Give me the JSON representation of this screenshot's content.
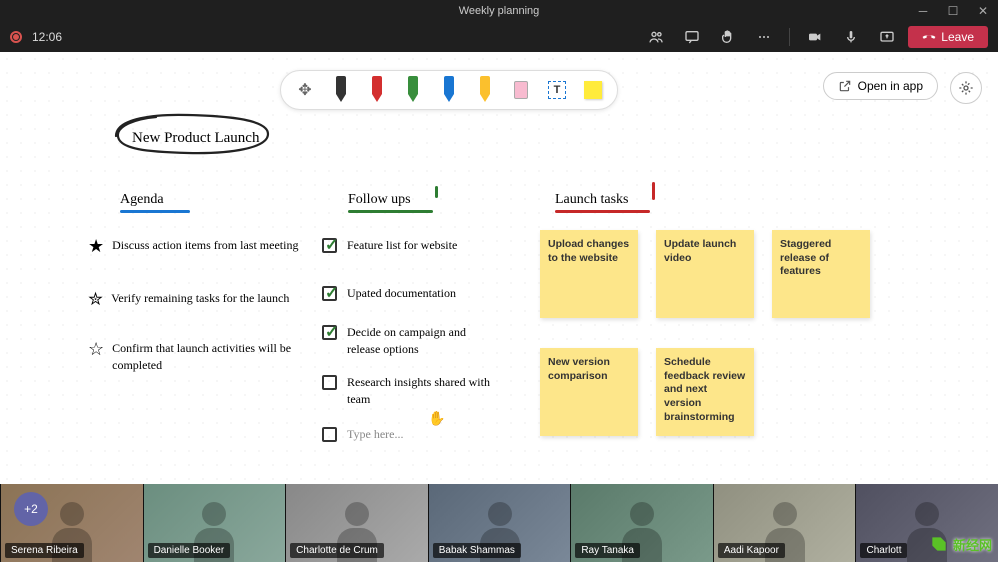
{
  "window": {
    "title": "Weekly planning"
  },
  "meeting_bar": {
    "timer": "12:06",
    "leave_label": "Leave"
  },
  "whiteboard": {
    "open_app_label": "Open in app",
    "title": "New Product Launch",
    "sections": {
      "agenda": {
        "label": "Agenda",
        "items": [
          "Discuss action items from last meeting",
          "Verify remaining tasks for the launch",
          "Confirm that launch activities will be completed"
        ]
      },
      "followups": {
        "label": "Follow ups",
        "items": [
          {
            "text": "Feature list for website",
            "checked": true
          },
          {
            "text": "Upated documentation",
            "checked": true
          },
          {
            "text": "Decide on campaign and release options",
            "checked": true
          },
          {
            "text": "Research insights shared with team",
            "checked": false
          }
        ],
        "placeholder": "Type here..."
      },
      "launch_tasks": {
        "label": "Launch tasks",
        "stickies": [
          "Upload changes to the website",
          "Update launch video",
          "Staggered release of features",
          "New version comparison",
          "Schedule feedback review and next version brainstorming"
        ]
      }
    }
  },
  "participants": {
    "overflow": "+2",
    "names": [
      "Serena Ribeira",
      "Danielle Booker",
      "Charlotte de Crum",
      "Babak Shammas",
      "Ray Tanaka",
      "Aadi Kapoor",
      "Charlott"
    ]
  },
  "watermark": "新经网"
}
